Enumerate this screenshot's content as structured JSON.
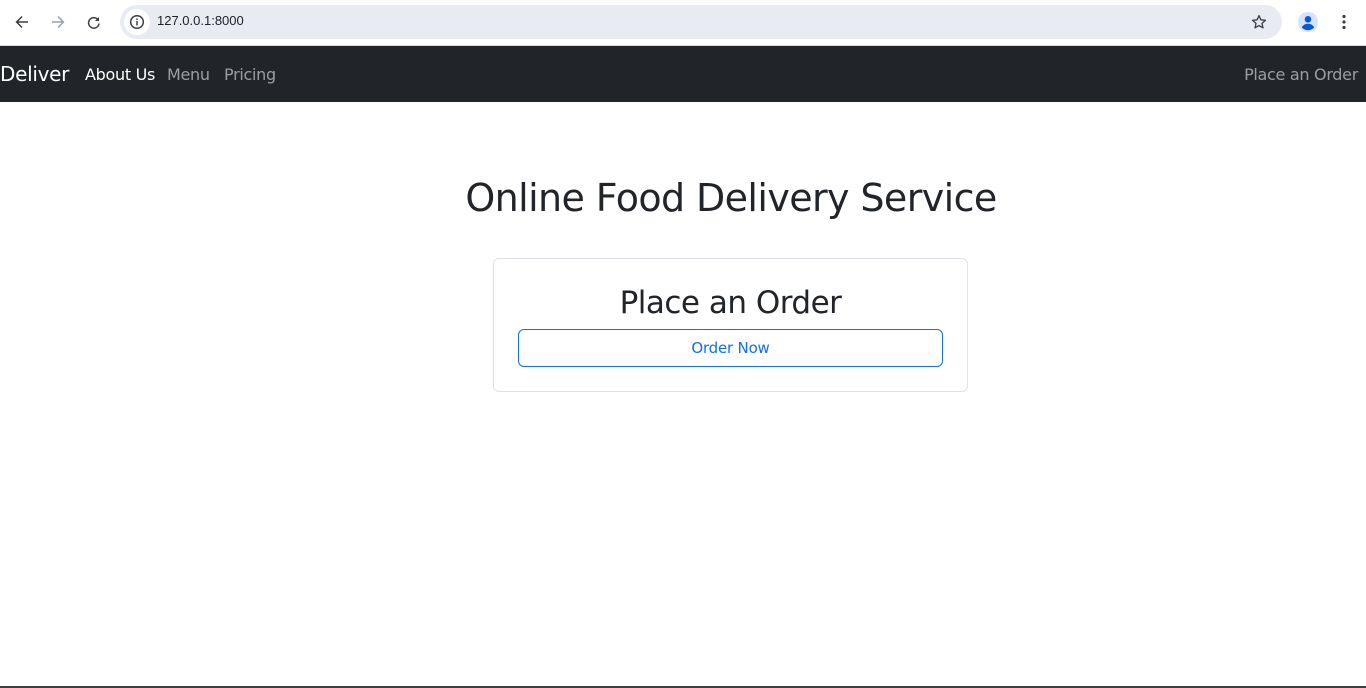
{
  "browser": {
    "url": "127.0.0.1:8000",
    "icons": {
      "back": "arrow-left-icon",
      "forward": "arrow-right-icon",
      "reload": "reload-icon",
      "site_info": "info-icon",
      "bookmark": "star-icon",
      "profile": "person-icon",
      "menu": "kebab-menu-icon"
    }
  },
  "navbar": {
    "brand": "Deliver",
    "links": [
      {
        "label": "About Us",
        "active": true
      },
      {
        "label": "Menu",
        "active": false
      },
      {
        "label": "Pricing",
        "active": false
      }
    ],
    "right_link": "Place an Order"
  },
  "main": {
    "title": "Online Food Delivery Service",
    "card": {
      "title": "Place an Order",
      "button_label": "Order Now"
    }
  },
  "colors": {
    "navbar_bg": "#212529",
    "accent": "#0d6efd",
    "text": "#212529",
    "omnibox_bg": "#e9ebf3",
    "profile_blue": "#0b57d0"
  }
}
